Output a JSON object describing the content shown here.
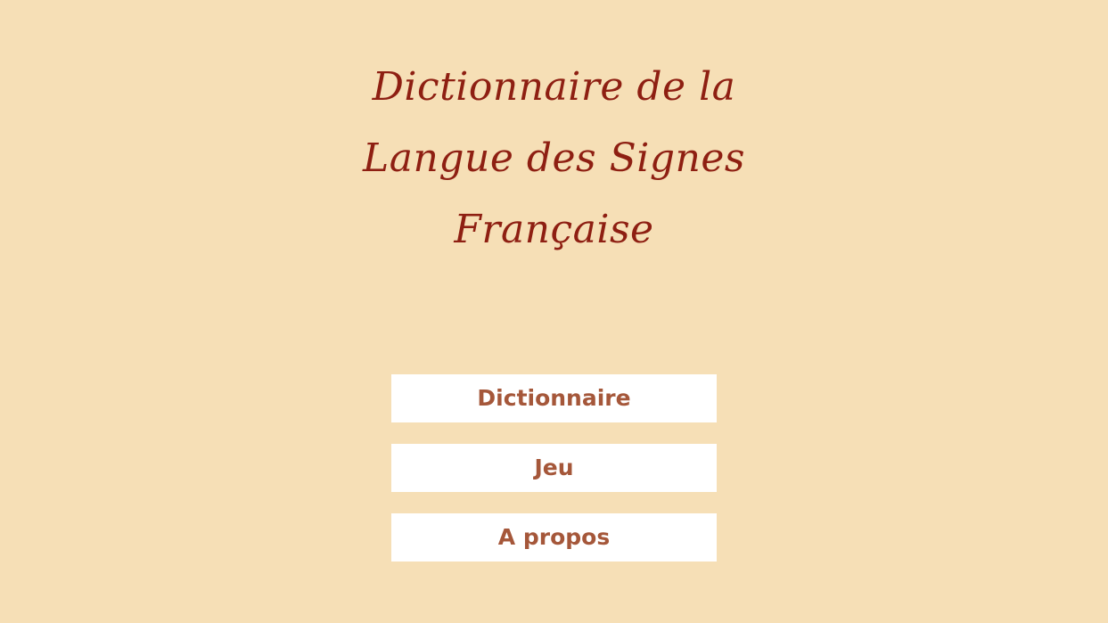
{
  "app": {
    "title_lines": [
      "Dictionnaire de la",
      "Langue des Signes",
      "Française"
    ]
  },
  "menu": {
    "items": [
      {
        "label": "Dictionnaire"
      },
      {
        "label": "Jeu"
      },
      {
        "label": "A propos"
      }
    ]
  },
  "colors": {
    "background": "#F6DFB6",
    "title": "#8E1F12",
    "button_background": "#FFFFFF",
    "button_text": "#A5573A"
  }
}
